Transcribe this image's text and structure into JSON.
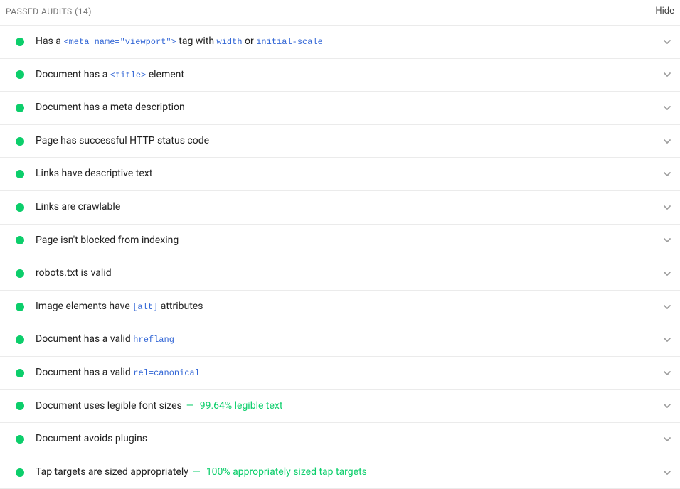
{
  "header": {
    "title_prefix": "PASSED AUDITS",
    "count": "(14)",
    "hide_label": "Hide"
  },
  "audits": [
    {
      "segments": [
        {
          "text": "Has a ",
          "type": "text"
        },
        {
          "text": "<meta name=\"viewport\">",
          "type": "code"
        },
        {
          "text": " tag with ",
          "type": "text"
        },
        {
          "text": "width",
          "type": "code"
        },
        {
          "text": " or ",
          "type": "text"
        },
        {
          "text": "initial-scale",
          "type": "code"
        }
      ]
    },
    {
      "segments": [
        {
          "text": "Document has a ",
          "type": "text"
        },
        {
          "text": "<title>",
          "type": "code"
        },
        {
          "text": " element",
          "type": "text"
        }
      ]
    },
    {
      "segments": [
        {
          "text": "Document has a meta description",
          "type": "text"
        }
      ]
    },
    {
      "segments": [
        {
          "text": "Page has successful HTTP status code",
          "type": "text"
        }
      ]
    },
    {
      "segments": [
        {
          "text": "Links have descriptive text",
          "type": "text"
        }
      ]
    },
    {
      "segments": [
        {
          "text": "Links are crawlable",
          "type": "text"
        }
      ]
    },
    {
      "segments": [
        {
          "text": "Page isn't blocked from indexing",
          "type": "text"
        }
      ]
    },
    {
      "segments": [
        {
          "text": "robots.txt is valid",
          "type": "text"
        }
      ]
    },
    {
      "segments": [
        {
          "text": "Image elements have ",
          "type": "text"
        },
        {
          "text": "[alt]",
          "type": "code"
        },
        {
          "text": " attributes",
          "type": "text"
        }
      ]
    },
    {
      "segments": [
        {
          "text": "Document has a valid ",
          "type": "text"
        },
        {
          "text": "hreflang",
          "type": "code"
        }
      ]
    },
    {
      "segments": [
        {
          "text": "Document has a valid ",
          "type": "text"
        },
        {
          "text": "rel=canonical",
          "type": "code"
        }
      ]
    },
    {
      "segments": [
        {
          "text": "Document uses legible font sizes",
          "type": "text"
        }
      ],
      "extra": "99.64% legible text"
    },
    {
      "segments": [
        {
          "text": "Document avoids plugins",
          "type": "text"
        }
      ]
    },
    {
      "segments": [
        {
          "text": "Tap targets are sized appropriately",
          "type": "text"
        }
      ],
      "extra": "100% appropriately sized tap targets"
    }
  ]
}
